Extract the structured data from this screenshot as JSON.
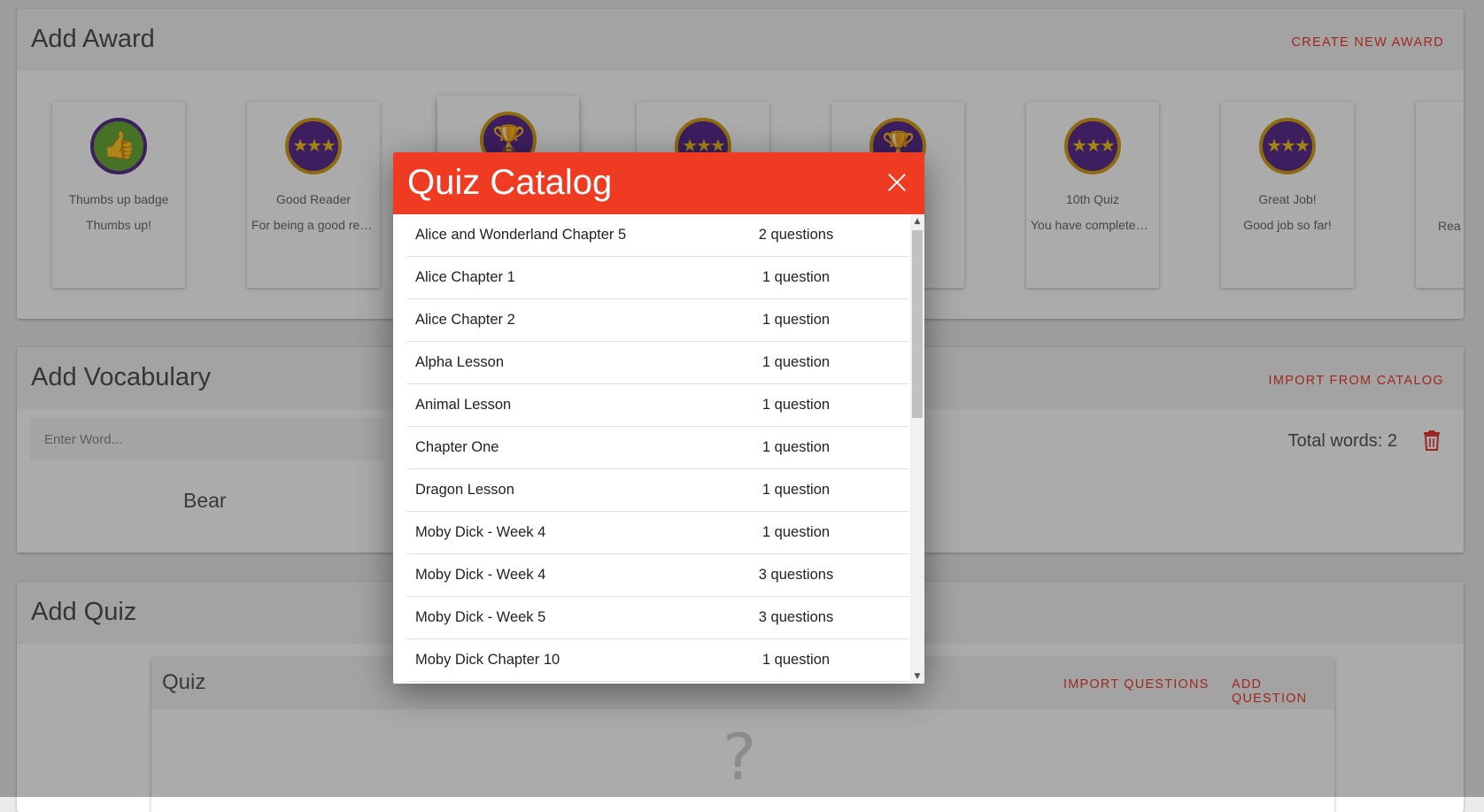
{
  "award_section": {
    "title": "Add Award",
    "action": "CREATE NEW AWARD",
    "awards": [
      {
        "name": "Thumbs up badge",
        "desc": "Thumbs up!",
        "icon": "thumbs-up-icon"
      },
      {
        "name": "Good Reader",
        "desc": "For being a good rea...",
        "icon": "stars-icon"
      },
      {
        "name": "",
        "desc": "",
        "icon": "trophy-icon"
      },
      {
        "name": "",
        "desc": "",
        "icon": "stars-icon"
      },
      {
        "name": "",
        "desc": "",
        "icon": "trophy-icon"
      },
      {
        "name": "10th Quiz",
        "desc": "You have completed ...",
        "icon": "stars-icon"
      },
      {
        "name": "Great Job!",
        "desc": "Good job so far!",
        "icon": "stars-icon"
      },
      {
        "name": "",
        "desc": "Rea",
        "icon": ""
      }
    ]
  },
  "vocabulary_section": {
    "title": "Add Vocabulary",
    "action": "IMPORT FROM CATALOG",
    "input_placeholder": "Enter Word...",
    "total_words": "Total words: 2",
    "words": [
      "Bear"
    ]
  },
  "quiz_section": {
    "title": "Add Quiz",
    "inner_title": "Quiz",
    "import_action": "IMPORT QUESTIONS",
    "add_action": "ADD QUESTION",
    "empty_glyph": "?"
  },
  "modal": {
    "title": "Quiz Catalog",
    "rows": [
      {
        "name": "Alice and Wonderland Chapter 5",
        "count": "2 questions"
      },
      {
        "name": "Alice Chapter 1",
        "count": "1 question"
      },
      {
        "name": "Alice Chapter 2",
        "count": "1 question"
      },
      {
        "name": "Alpha Lesson",
        "count": "1 question"
      },
      {
        "name": "Animal Lesson",
        "count": "1 question"
      },
      {
        "name": "Chapter One",
        "count": "1 question"
      },
      {
        "name": "Dragon Lesson",
        "count": "1 question"
      },
      {
        "name": "Moby Dick - Week 4",
        "count": "1 question"
      },
      {
        "name": "Moby Dick - Week 4",
        "count": "3 questions"
      },
      {
        "name": "Moby Dick - Week 5",
        "count": "3 questions"
      },
      {
        "name": "Moby Dick Chapter 10",
        "count": "1 question"
      }
    ]
  },
  "colors": {
    "accent": "#ef3b22",
    "badge_purple": "#5a2d91",
    "badge_gold": "#d4a017"
  }
}
